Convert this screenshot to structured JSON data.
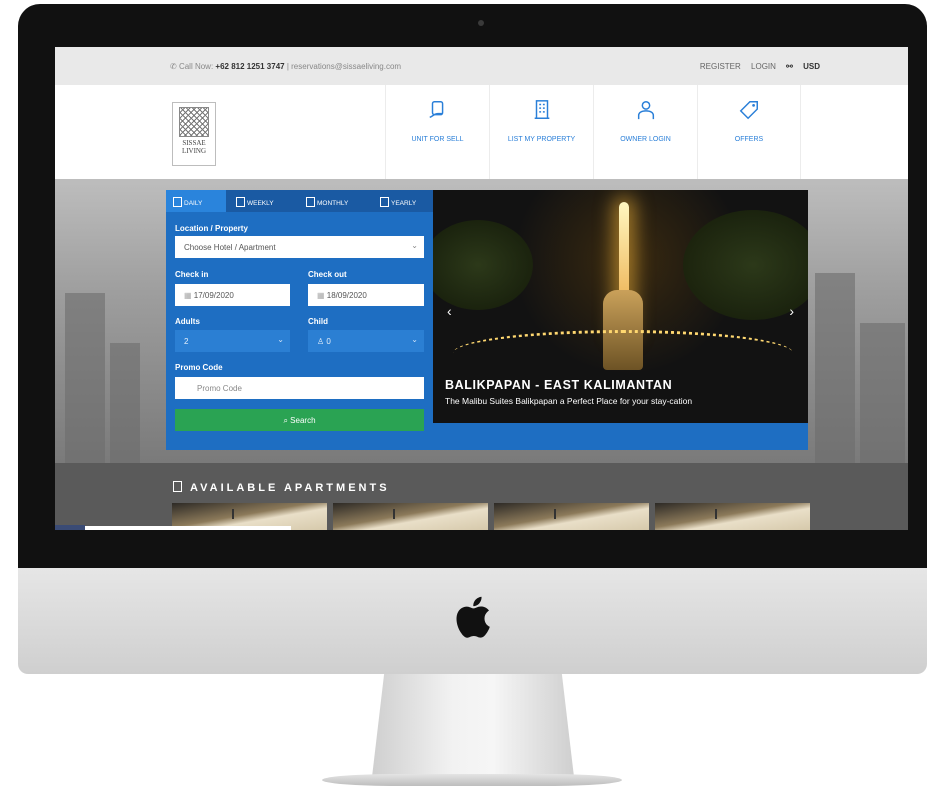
{
  "topbar": {
    "call_prefix": "Call Now:",
    "phone": "+62 812 1251 3747",
    "separator": "|",
    "email": "reservations@sissaeliving.com",
    "register": "REGISTER",
    "login": "LOGIN",
    "currency": "USD"
  },
  "logo": {
    "line1": "SISSAE",
    "line2": "LIVING"
  },
  "nav": [
    {
      "label": "UNIT FOR SELL",
      "icon": "hand-card-icon"
    },
    {
      "label": "LIST MY PROPERTY",
      "icon": "building-icon"
    },
    {
      "label": "OWNER LOGIN",
      "icon": "owner-icon"
    },
    {
      "label": "OFFERS",
      "icon": "tag-icon"
    }
  ],
  "booking": {
    "tabs": [
      "DAILY",
      "WEEKLY",
      "MONTHLY",
      "YEARLY"
    ],
    "active_tab": "DAILY",
    "location_label": "Location / Property",
    "location_value": "Choose Hotel / Apartment",
    "checkin_label": "Check in",
    "checkin_value": "17/09/2020",
    "checkout_label": "Check out",
    "checkout_value": "18/09/2020",
    "adults_label": "Adults",
    "adults_value": "2",
    "child_label": "Child",
    "child_value": "0",
    "promo_label": "Promo Code",
    "promo_placeholder": "Promo Code",
    "search_label": "Search"
  },
  "slide": {
    "title": "BALIKPAPAN - EAST KALIMANTAN",
    "subtitle": "The Malibu Suites Balikpapan a Perfect Place for your stay-cation"
  },
  "available": {
    "title": "AVAILABLE APARTMENTS"
  },
  "colors": {
    "accent_blue": "#1e6ec2",
    "search_green": "#2aa353",
    "link_blue": "#2a7fd8"
  }
}
